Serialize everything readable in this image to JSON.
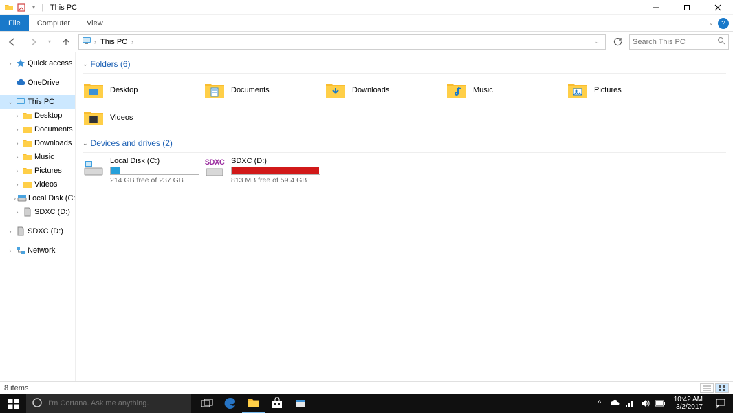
{
  "window": {
    "title": "This PC"
  },
  "ribbon": {
    "file": "File",
    "computer": "Computer",
    "view": "View"
  },
  "address": {
    "location": "This PC",
    "search_placeholder": "Search This PC"
  },
  "sidebar": {
    "quick_access": "Quick access",
    "onedrive": "OneDrive",
    "this_pc": "This PC",
    "children": {
      "desktop": "Desktop",
      "documents": "Documents",
      "downloads": "Downloads",
      "music": "Music",
      "pictures": "Pictures",
      "videos": "Videos",
      "local_disk": "Local Disk (C:)",
      "sdxc": "SDXC (D:)"
    },
    "sdxc_root": "SDXC (D:)",
    "network": "Network"
  },
  "sections": {
    "folders_header": "Folders (6)",
    "drives_header": "Devices and drives (2)"
  },
  "folders": {
    "desktop": "Desktop",
    "documents": "Documents",
    "downloads": "Downloads",
    "music": "Music",
    "pictures": "Pictures",
    "videos": "Videos"
  },
  "drives": {
    "c": {
      "name": "Local Disk (C:)",
      "free": "214 GB free of 237 GB",
      "fill_pct": 10,
      "color": "#26a0da"
    },
    "d": {
      "name": "SDXC (D:)",
      "free": "813 MB free of 59.4 GB",
      "fill_pct": 99,
      "color": "#d11919",
      "badge": "SDXC"
    }
  },
  "status": {
    "items": "8 items"
  },
  "taskbar": {
    "cortana_placeholder": "I'm Cortana. Ask me anything.",
    "time": "10:42 AM",
    "date": "3/2/2017"
  }
}
